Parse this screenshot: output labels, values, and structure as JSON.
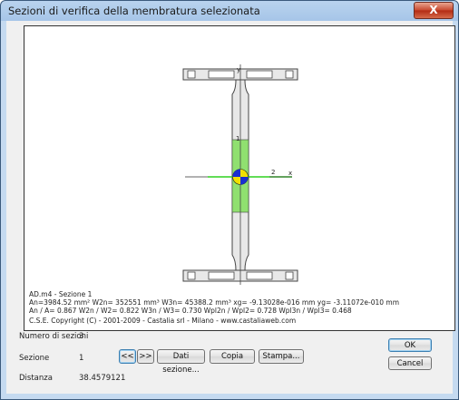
{
  "window": {
    "title": "Sezioni di verifica della membratura selezionata",
    "close_glyph": "X"
  },
  "canvas": {
    "axis_y_label": "y",
    "axis_x_label": "x",
    "marker_1": "1",
    "marker_2": "2",
    "info_line1": "AD.m4 - Sezione 1",
    "info_line2": "An=3984.52 mm² W2n= 352551 mm³ W3n= 45388.2 mm³  xg= -9.13028e-016 mm  yg= -3.11072e-010 mm",
    "info_line3": "An / A=  0.867 W2n / W2=   0.822 W3n / W3=    0.730  Wpl2n / Wpl2=    0.728 Wpl3n / Wpl3=    0.468",
    "copyright": "C.S.E. Copyright (C) - 2001-2009 - Castalia srl - Milano - www.castaliaweb.com"
  },
  "fields": {
    "num_sezioni_label": "Numero di sezioni",
    "num_sezioni_value": "3",
    "sezione_label": "Sezione",
    "sezione_value": "1",
    "distanza_label": "Distanza",
    "distanza_value": "38.4579121"
  },
  "buttons": {
    "prev": "<<",
    "next": ">>",
    "dati": "Dati sezione...",
    "copia": "Copia",
    "stampa": "Stampa...",
    "ok": "OK",
    "cancel": "Cancel"
  },
  "colors": {
    "web_highlight": "#90e070",
    "centroid_blue": "#1a2fd0",
    "centroid_yellow": "#f0e000",
    "axis_green": "#2fd21f"
  }
}
